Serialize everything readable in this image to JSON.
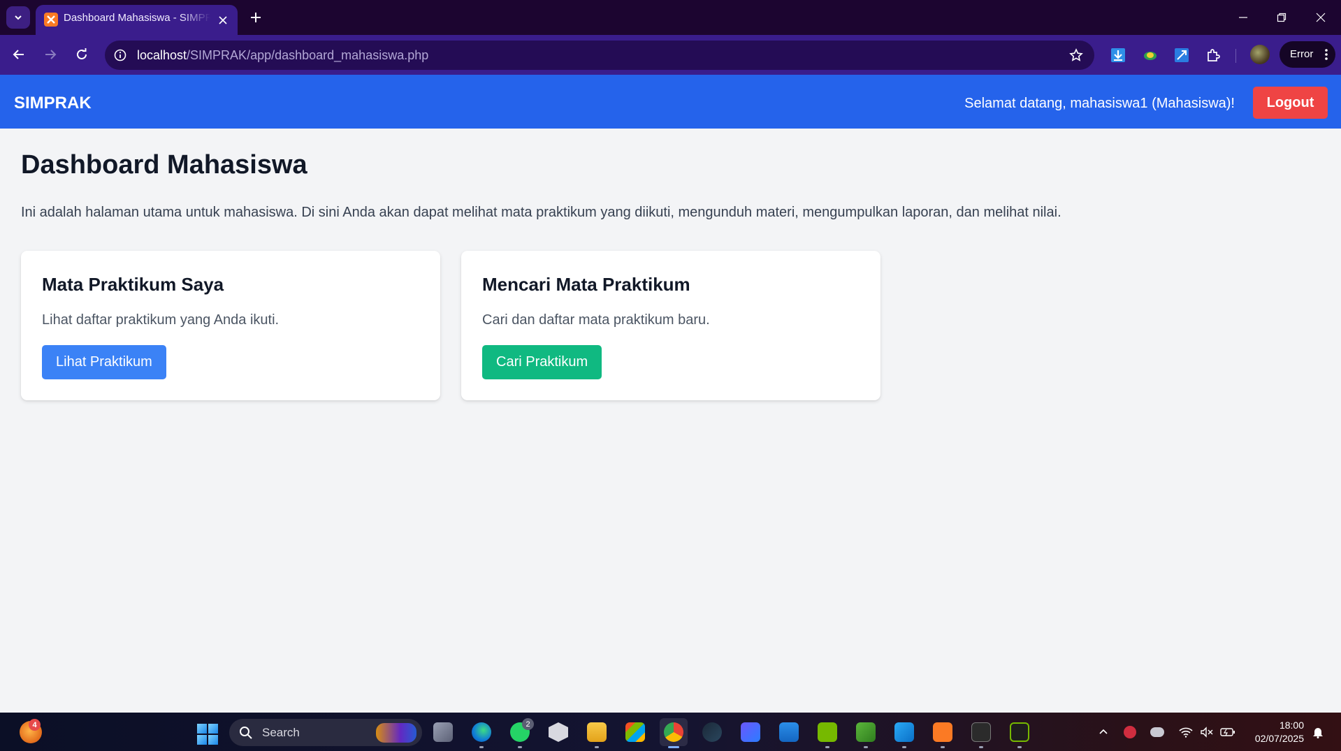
{
  "browser": {
    "tab": {
      "title": "Dashboard Mahasiswa - SIMPRAK"
    },
    "url": {
      "host": "localhost",
      "path": "/SIMPRAK/app/dashboard_mahasiswa.php"
    },
    "profile_menu_label": "Error"
  },
  "app": {
    "brand": "SIMPRAK",
    "welcome_text": "Selamat datang, mahasiswa1 (Mahasiswa)!",
    "logout_label": "Logout",
    "page_title": "Dashboard Mahasiswa",
    "page_description": "Ini adalah halaman utama untuk mahasiswa. Di sini Anda akan dapat melihat mata praktikum yang diikuti, mengunduh materi, mengumpulkan laporan, dan melihat nilai.",
    "cards": [
      {
        "title": "Mata Praktikum Saya",
        "text": "Lihat daftar praktikum yang Anda ikuti.",
        "button": "Lihat Praktikum",
        "button_color": "#3b82f6"
      },
      {
        "title": "Mencari Mata Praktikum",
        "text": "Cari dan daftar mata praktikum baru.",
        "button": "Cari Praktikum",
        "button_color": "#10b981"
      }
    ],
    "colors": {
      "header": "#2563eb",
      "logout": "#ef4444",
      "background": "#f3f4f6"
    }
  },
  "taskbar": {
    "weather_badge": "4",
    "search_placeholder": "Search",
    "whatsapp_badge": "2",
    "time": "18:00",
    "date": "02/07/2025"
  }
}
